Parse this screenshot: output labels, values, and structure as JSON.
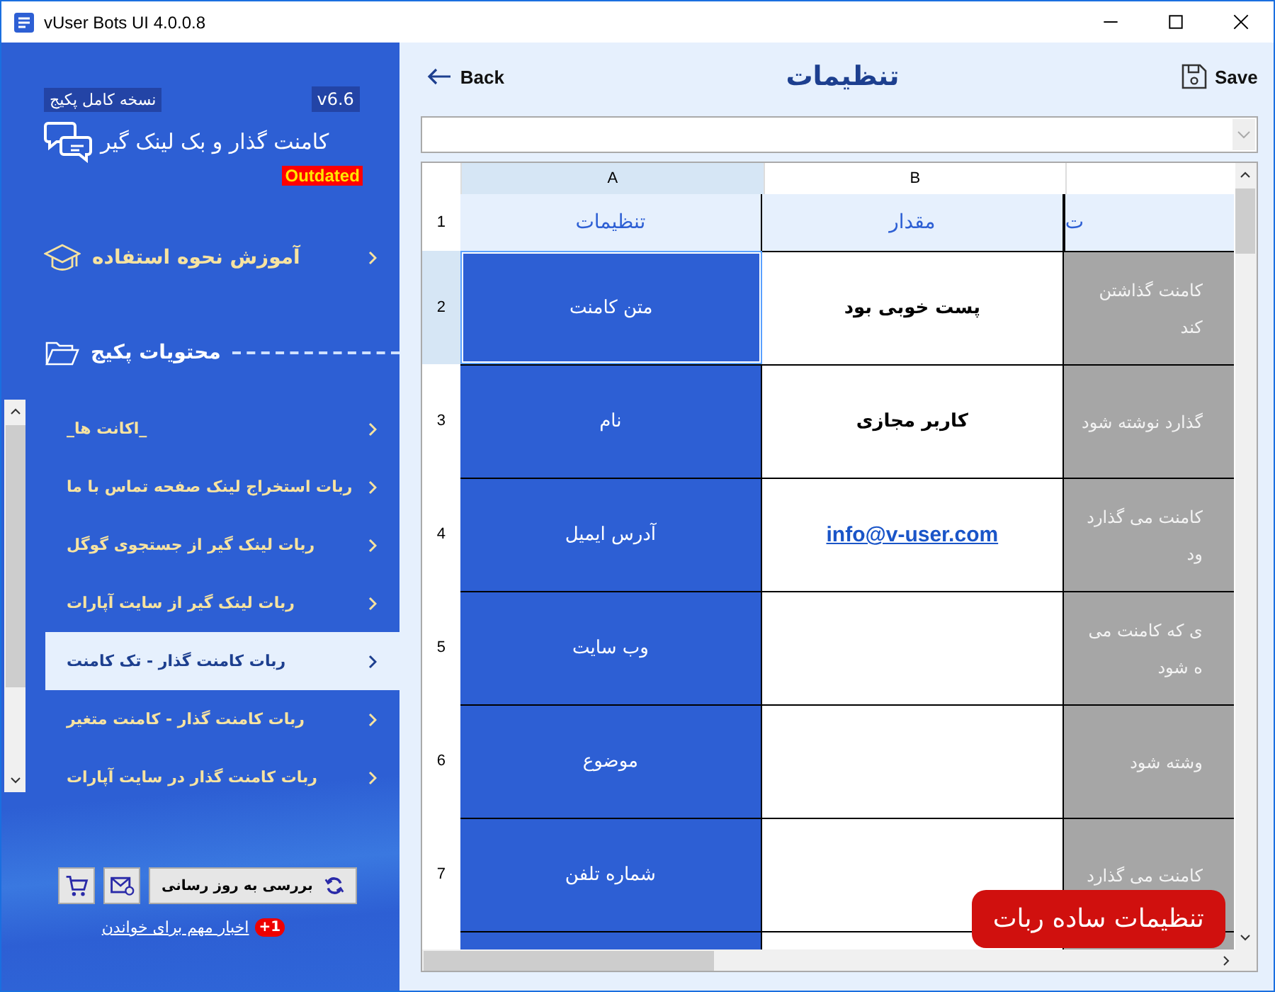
{
  "window": {
    "title": "vUser Bots UI 4.0.0.8"
  },
  "sidebar": {
    "edition_badge": "نسخه کامل پکیج",
    "version": "v6.6",
    "app_title": "کامنت گذار و بک لینک گیر",
    "status_badge": "Outdated",
    "tutorial_link": "آموزش نحوه استفاده",
    "section_title": "محتویات پکیج",
    "items": [
      {
        "label": "_اکانت ها_",
        "selected": false
      },
      {
        "label": "ربات استخراج لینک صفحه تماس با ما",
        "selected": false
      },
      {
        "label": "ربات لینک گیر از جستجوی گوگل",
        "selected": false
      },
      {
        "label": "ربات لینک گیر از سایت آپارات",
        "selected": false
      },
      {
        "label": "ربات کامنت گذار - تک کامنت",
        "selected": true
      },
      {
        "label": "ربات کامنت گذار - کامنت متغیر",
        "selected": false
      },
      {
        "label": "ربات کامنت گذار در سایت آپارات",
        "selected": false
      }
    ],
    "update_button": "بررسی به روز رسانی",
    "news_count": "+1",
    "news_link": "اخبار مهم برای خواندن"
  },
  "toolbar": {
    "back": "Back",
    "title": "تنظیمات",
    "save": "Save"
  },
  "sheet": {
    "column_letters": {
      "col_a": "A",
      "col_b": "B"
    },
    "header_number": "1",
    "header": {
      "col_a": "تنظیمات",
      "col_b": "مقدار",
      "col_c": "ت"
    },
    "rows": [
      {
        "number": "2",
        "label": "متن کامنت",
        "kind": "text",
        "value": "پست خوبی بود",
        "note": [
          "کامنت گذاشتن",
          "کند"
        ],
        "selected": true
      },
      {
        "number": "3",
        "label": "نام",
        "kind": "text",
        "value": "کاربر مجازی",
        "note": [
          "گذارد نوشته شود"
        ],
        "selected": false
      },
      {
        "number": "4",
        "label": "آدرس ایمیل",
        "kind": "link",
        "value": "info@v-user.com",
        "note": [
          "کامنت می گذارد",
          "ود"
        ],
        "selected": false
      },
      {
        "number": "5",
        "label": "وب سایت",
        "kind": "text",
        "note": [
          "ی که کامنت می",
          "ه شود"
        ],
        "selected": false
      },
      {
        "number": "6",
        "label": "موضوع",
        "kind": "text",
        "note": [
          "وشته شود"
        ],
        "selected": false
      },
      {
        "number": "7",
        "label": "شماره تلفن",
        "kind": "text",
        "note": [
          "کامنت می گذارد"
        ],
        "selected": false
      }
    ]
  },
  "floating_badge": "تنظیمات ساده ربات"
}
